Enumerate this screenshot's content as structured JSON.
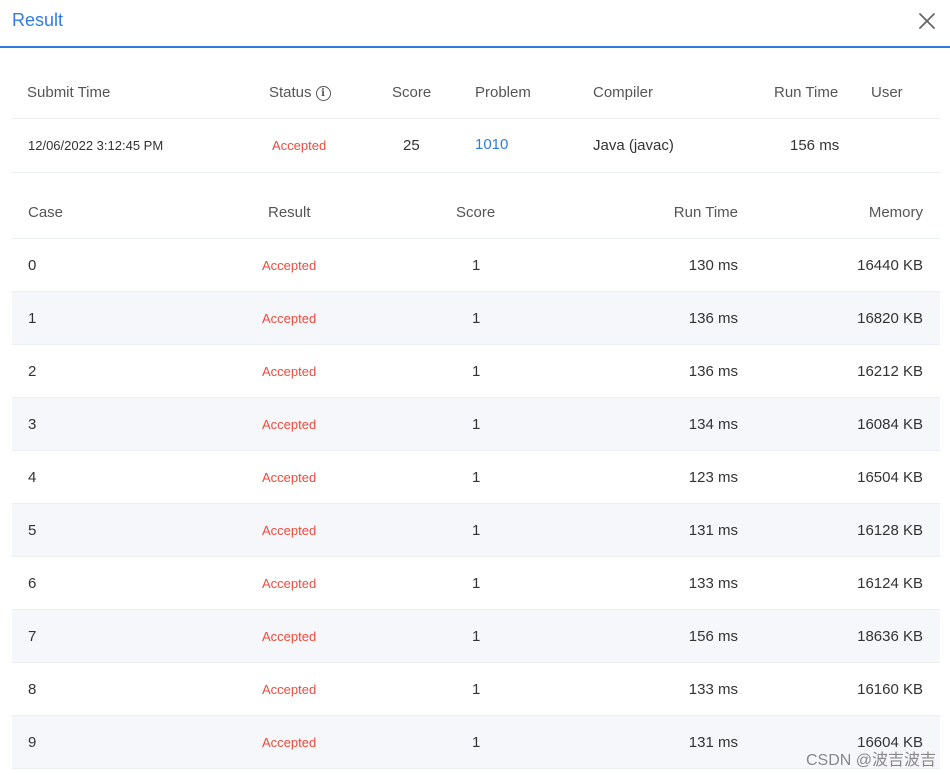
{
  "dialog": {
    "title": "Result"
  },
  "summary": {
    "headers": {
      "submit_time": "Submit Time",
      "status": "Status",
      "score": "Score",
      "problem": "Problem",
      "compiler": "Compiler",
      "run_time": "Run Time",
      "user": "User"
    },
    "status_info_icon": "info-icon",
    "row": {
      "submit_time": "12/06/2022 3:12:45 PM",
      "status": "Accepted",
      "score": "25",
      "problem": "1010",
      "compiler": "Java (javac)",
      "run_time": "156 ms",
      "user": ""
    }
  },
  "cases": {
    "headers": {
      "case": "Case",
      "result": "Result",
      "score": "Score",
      "run_time": "Run Time",
      "memory": "Memory"
    },
    "rows": [
      {
        "case": "0",
        "result": "Accepted",
        "score": "1",
        "run_time": "130 ms",
        "memory": "16440 KB"
      },
      {
        "case": "1",
        "result": "Accepted",
        "score": "1",
        "run_time": "136 ms",
        "memory": "16820 KB"
      },
      {
        "case": "2",
        "result": "Accepted",
        "score": "1",
        "run_time": "136 ms",
        "memory": "16212 KB"
      },
      {
        "case": "3",
        "result": "Accepted",
        "score": "1",
        "run_time": "134 ms",
        "memory": "16084 KB"
      },
      {
        "case": "4",
        "result": "Accepted",
        "score": "1",
        "run_time": "123 ms",
        "memory": "16504 KB"
      },
      {
        "case": "5",
        "result": "Accepted",
        "score": "1",
        "run_time": "131 ms",
        "memory": "16128 KB"
      },
      {
        "case": "6",
        "result": "Accepted",
        "score": "1",
        "run_time": "133 ms",
        "memory": "16124 KB"
      },
      {
        "case": "7",
        "result": "Accepted",
        "score": "1",
        "run_time": "156 ms",
        "memory": "18636 KB"
      },
      {
        "case": "8",
        "result": "Accepted",
        "score": "1",
        "run_time": "133 ms",
        "memory": "16160 KB"
      },
      {
        "case": "9",
        "result": "Accepted",
        "score": "1",
        "run_time": "131 ms",
        "memory": "16604 KB"
      }
    ]
  },
  "watermark": "CSDN @波吉波吉",
  "colors": {
    "accent": "#2f7de1",
    "accepted": "#ee4b3c",
    "row_alt": "#f5f7fa",
    "divider": "#ebeef5"
  }
}
